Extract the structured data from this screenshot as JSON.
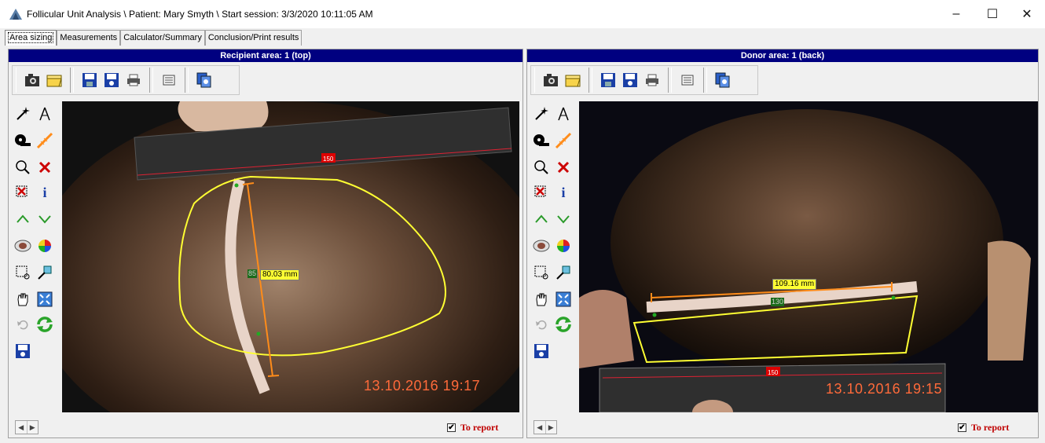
{
  "window": {
    "title": "Follicular Unit Analysis  \\ Patient: Mary Smyth \\ Start session: 3/3/2020 10:11:05 AM",
    "minimize": "–",
    "maximize": "☐",
    "close": "✕"
  },
  "tabs": [
    {
      "label": "Area sizing",
      "active": true
    },
    {
      "label": "Measurements",
      "active": false
    },
    {
      "label": "Calculator/Summary",
      "active": false
    },
    {
      "label": "Conclusion/Print results",
      "active": false
    }
  ],
  "left_panel": {
    "header": "Recipient area: 1 (top)",
    "measurement": "80.03 mm",
    "marker": "85",
    "ruler_marker": "150",
    "datestamp": "13.10.2016  19:17",
    "to_report_label": "To report",
    "to_report_checked": true
  },
  "right_panel": {
    "header": "Donor area: 1 (back)",
    "measurement": "109.16 mm",
    "marker": "130",
    "ruler_marker": "150",
    "datestamp": "13.10.2016  19:15",
    "to_report_label": "To report",
    "to_report_checked": true
  },
  "toolbar_icons": [
    "camera-icon",
    "open-folder-icon",
    "save-icon",
    "save-as-icon",
    "print-icon",
    "list-icon",
    "copy-icon"
  ],
  "tool_icons": [
    "magic-wand-icon",
    "compass-icon",
    "tape-measure-icon",
    "ruler-icon",
    "zoom-region-icon",
    "delete-icon",
    "delete-region-icon",
    "info-icon",
    "expand-arrows-icon",
    "shrink-arrows-icon",
    "eye-icon",
    "color-wheel-icon",
    "select-rect-icon",
    "pipette-icon",
    "hand-icon",
    "fit-view-icon",
    "undo-icon",
    "refresh-icon",
    "save-disk-icon"
  ],
  "colors": {
    "header_bg": "#000080",
    "outline": "#ffff33",
    "measure_line": "#ff8c1a",
    "report_text": "#c00000",
    "datestamp": "#ff6a3a"
  }
}
